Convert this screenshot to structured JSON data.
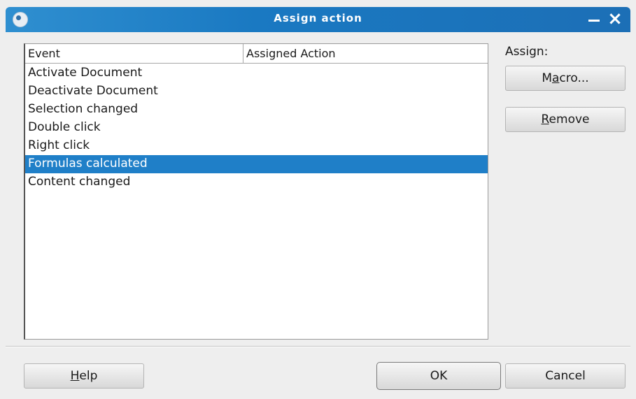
{
  "window": {
    "title": "Assign action",
    "title_bar_color": "#1a79c2"
  },
  "events_list": {
    "columns": [
      "Event",
      "Assigned Action"
    ],
    "rows": [
      {
        "event": "Activate Document",
        "action": "",
        "selected": false
      },
      {
        "event": "Deactivate Document",
        "action": "",
        "selected": false
      },
      {
        "event": "Selection changed",
        "action": "",
        "selected": false
      },
      {
        "event": "Double click",
        "action": "",
        "selected": false
      },
      {
        "event": "Right click",
        "action": "",
        "selected": false
      },
      {
        "event": "Formulas calculated",
        "action": "",
        "selected": true
      },
      {
        "event": "Content changed",
        "action": "",
        "selected": false
      }
    ],
    "selection_color": "#1f7fc8"
  },
  "assign": {
    "label": "Assign:",
    "macro_button": {
      "pre": "M",
      "mnemonic": "a",
      "post": "cro..."
    },
    "remove_button": {
      "pre": "",
      "mnemonic": "R",
      "post": "emove"
    }
  },
  "footer": {
    "help_button": {
      "pre": "",
      "mnemonic": "H",
      "post": "elp"
    },
    "ok_button": "OK",
    "cancel_button": "Cancel"
  },
  "icons": {
    "app": "app-icon",
    "minimize": "minimize-icon",
    "close": "close-icon"
  }
}
